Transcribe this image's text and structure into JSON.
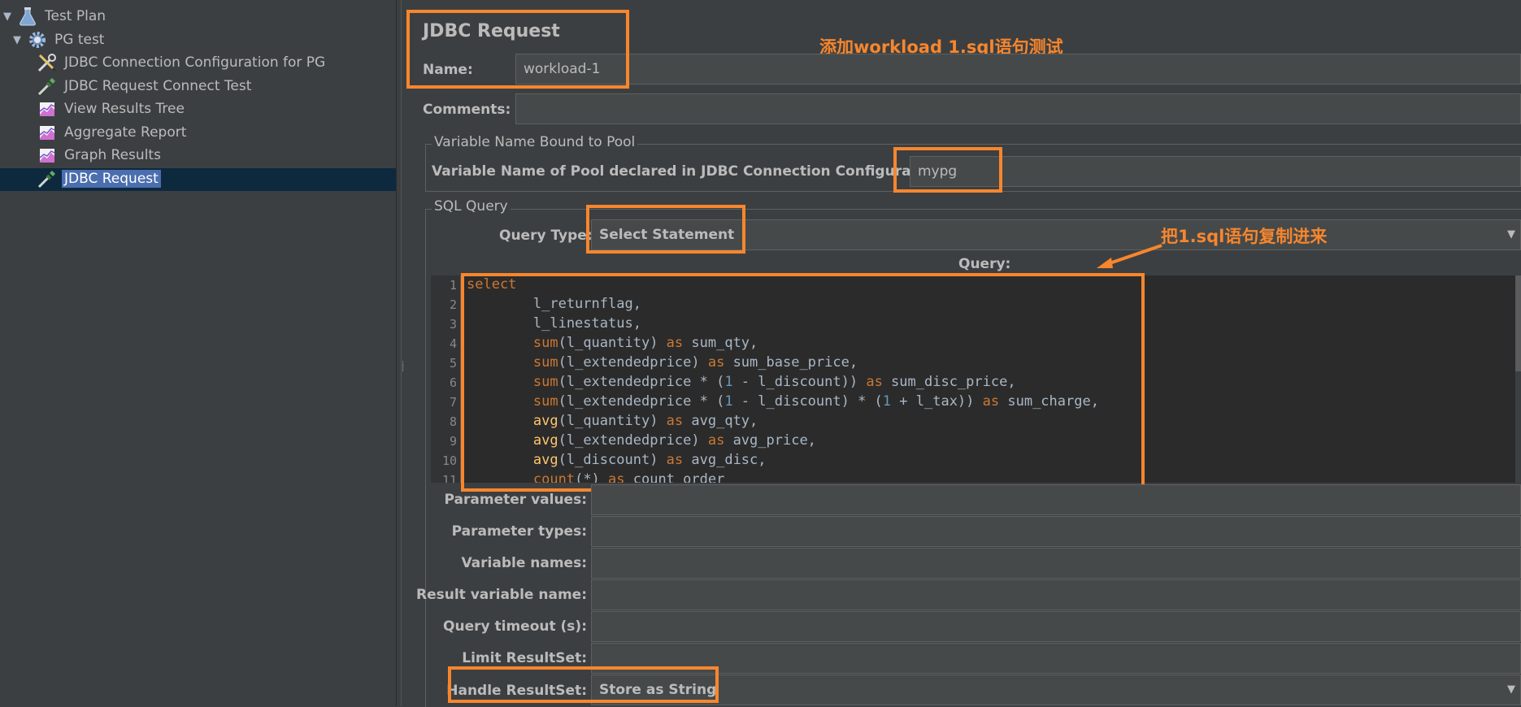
{
  "tree": {
    "items": [
      {
        "label": "Test Plan",
        "icon": "flask-icon",
        "expanded": true
      },
      {
        "label": "PG test",
        "icon": "gear-icon",
        "expanded": true
      },
      {
        "label": "JDBC Connection Configuration for PG",
        "icon": "wrench-screwdriver-icon"
      },
      {
        "label": "JDBC Request Connect Test",
        "icon": "pipette-icon"
      },
      {
        "label": "View Results Tree",
        "icon": "chart-icon"
      },
      {
        "label": "Aggregate Report",
        "icon": "chart-icon"
      },
      {
        "label": "Graph Results",
        "icon": "chart-icon"
      },
      {
        "label": "JDBC Request",
        "icon": "pipette-icon",
        "selected": true
      }
    ]
  },
  "panel": {
    "title": "JDBC Request",
    "name_label": "Name:",
    "name_value": "workload-1",
    "comments_label": "Comments:",
    "comments_value": "",
    "pool_group_title": "Variable Name Bound to Pool",
    "pool_label": "Variable Name of Pool declared in JDBC Connection Configuration:",
    "pool_value": "mypg",
    "sql_group_title": "SQL Query",
    "query_type_label": "Query Type:",
    "query_type_value": "Select Statement",
    "query_label": "Query:",
    "param_values_label": "Parameter values:",
    "param_types_label": "Parameter types:",
    "var_names_label": "Variable names:",
    "result_var_label": "Result variable name:",
    "timeout_label": "Query timeout (s):",
    "limit_label": "Limit ResultSet:",
    "handle_label": "Handle ResultSet:",
    "handle_value": "Store as String"
  },
  "annotations": {
    "note1": "添加workload 1.sql语句测试",
    "note2": "把1.sql语句复制进来"
  },
  "colors": {
    "accent_orange": "#f7862d",
    "selection_blue": "#4b6eaf",
    "keyword": "#cc7832",
    "function": "#ffc66d",
    "number": "#6897bb"
  },
  "query_lines": [
    [
      {
        "t": "select",
        "c": "kw"
      }
    ],
    [
      {
        "t": "        l_returnflag,",
        "c": ""
      }
    ],
    [
      {
        "t": "        l_linestatus,",
        "c": ""
      }
    ],
    [
      {
        "t": "        ",
        "c": ""
      },
      {
        "t": "sum",
        "c": "kw"
      },
      {
        "t": "(l_quantity) ",
        "c": ""
      },
      {
        "t": "as",
        "c": "kw"
      },
      {
        "t": " sum_qty,",
        "c": ""
      }
    ],
    [
      {
        "t": "        ",
        "c": ""
      },
      {
        "t": "sum",
        "c": "kw"
      },
      {
        "t": "(l_extendedprice) ",
        "c": ""
      },
      {
        "t": "as",
        "c": "kw"
      },
      {
        "t": " sum_base_price,",
        "c": ""
      }
    ],
    [
      {
        "t": "        ",
        "c": ""
      },
      {
        "t": "sum",
        "c": "kw"
      },
      {
        "t": "(l_extendedprice * (",
        "c": ""
      },
      {
        "t": "1",
        "c": "num"
      },
      {
        "t": " - l_discount)) ",
        "c": ""
      },
      {
        "t": "as",
        "c": "kw"
      },
      {
        "t": " sum_disc_price,",
        "c": ""
      }
    ],
    [
      {
        "t": "        ",
        "c": ""
      },
      {
        "t": "sum",
        "c": "kw"
      },
      {
        "t": "(l_extendedprice * (",
        "c": ""
      },
      {
        "t": "1",
        "c": "num"
      },
      {
        "t": " - l_discount) * (",
        "c": ""
      },
      {
        "t": "1",
        "c": "num"
      },
      {
        "t": " + l_tax)) ",
        "c": ""
      },
      {
        "t": "as",
        "c": "kw"
      },
      {
        "t": " sum_charge,",
        "c": ""
      }
    ],
    [
      {
        "t": "        ",
        "c": ""
      },
      {
        "t": "avg",
        "c": "fn"
      },
      {
        "t": "(l_quantity) ",
        "c": ""
      },
      {
        "t": "as",
        "c": "kw"
      },
      {
        "t": " avg_qty,",
        "c": ""
      }
    ],
    [
      {
        "t": "        ",
        "c": ""
      },
      {
        "t": "avg",
        "c": "fn"
      },
      {
        "t": "(l_extendedprice) ",
        "c": ""
      },
      {
        "t": "as",
        "c": "kw"
      },
      {
        "t": " avg_price,",
        "c": ""
      }
    ],
    [
      {
        "t": "        ",
        "c": ""
      },
      {
        "t": "avg",
        "c": "fn"
      },
      {
        "t": "(l_discount) ",
        "c": ""
      },
      {
        "t": "as",
        "c": "kw"
      },
      {
        "t": " avg_disc,",
        "c": ""
      }
    ],
    [
      {
        "t": "        ",
        "c": ""
      },
      {
        "t": "count",
        "c": "kw"
      },
      {
        "t": "(*) ",
        "c": ""
      },
      {
        "t": "as",
        "c": "kw"
      },
      {
        "t": " count_order",
        "c": ""
      }
    ]
  ]
}
